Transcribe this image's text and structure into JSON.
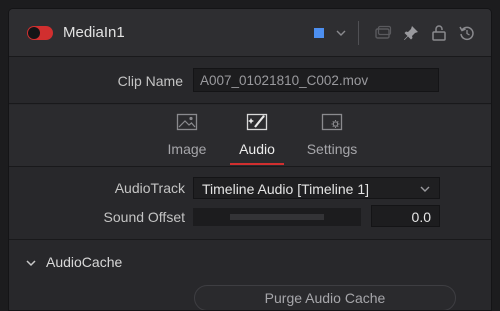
{
  "header": {
    "node_name": "MediaIn1",
    "toggle_state": "on",
    "toggle_color": "#d12f2f",
    "color_swatch": "#4d8ff0",
    "icons": [
      "color-swatch-dropdown-icon",
      "versions-icon",
      "pin-icon",
      "lock-icon",
      "reset-icon"
    ]
  },
  "clip": {
    "label": "Clip Name",
    "value": "A007_01021810_C002.mov"
  },
  "tabs": [
    {
      "label": "Image",
      "icon": "image-icon",
      "active": false
    },
    {
      "label": "Audio",
      "icon": "audio-icon",
      "active": true
    },
    {
      "label": "Settings",
      "icon": "settings-icon",
      "active": false
    }
  ],
  "audio": {
    "track_label": "AudioTrack",
    "track_value": "Timeline Audio [Timeline 1]",
    "offset_label": "Sound Offset",
    "offset_value": "0.0"
  },
  "cache": {
    "title": "AudioCache",
    "expanded": true,
    "purge_label": "Purge Audio Cache"
  },
  "colors": {
    "accent": "#d12f2f",
    "panel_bg": "#28282b"
  }
}
